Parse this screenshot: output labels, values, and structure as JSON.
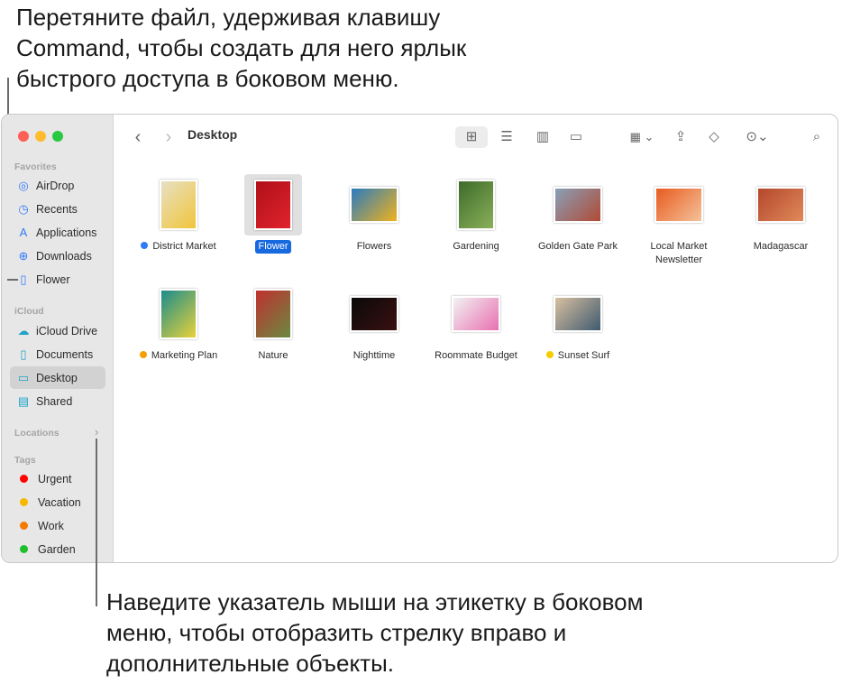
{
  "callouts": {
    "top": "Перетяните файл, удерживая клавишу Command, чтобы создать для него ярлык быстрого доступа в боковом меню.",
    "bottom": "Наведите указатель мыши на этикетку в боковом меню, чтобы отобразить стрелку вправо и дополнительные объекты."
  },
  "sidebar": {
    "favorites_label": "Favorites",
    "favorites": [
      {
        "label": "AirDrop",
        "icon": "airdrop-icon"
      },
      {
        "label": "Recents",
        "icon": "clock-icon"
      },
      {
        "label": "Applications",
        "icon": "applications-icon"
      },
      {
        "label": "Downloads",
        "icon": "download-icon"
      },
      {
        "label": "Flower",
        "icon": "document-icon"
      }
    ],
    "icloud_label": "iCloud",
    "icloud": [
      {
        "label": "iCloud Drive",
        "icon": "cloud-icon"
      },
      {
        "label": "Documents",
        "icon": "document-icon"
      },
      {
        "label": "Desktop",
        "icon": "desktop-icon"
      },
      {
        "label": "Shared",
        "icon": "shared-folder-icon"
      }
    ],
    "locations_label": "Locations",
    "tags_label": "Tags",
    "tags": [
      {
        "label": "Urgent",
        "color": "#fe0000"
      },
      {
        "label": "Vacation",
        "color": "#f5b700"
      },
      {
        "label": "Work",
        "color": "#f57a00"
      },
      {
        "label": "Garden",
        "color": "#1dbf2a"
      }
    ]
  },
  "toolbar": {
    "title": "Desktop"
  },
  "files": [
    {
      "name": "District Market",
      "tag": "#2f7bf6",
      "colors": [
        "#e8e0c4",
        "#f0c53a"
      ]
    },
    {
      "name": "Flower",
      "selected": true,
      "colors": [
        "#b0101a",
        "#e0232b"
      ]
    },
    {
      "name": "Flowers",
      "colors": [
        "#2a7bc0",
        "#f0b21c"
      ]
    },
    {
      "name": "Gardening",
      "colors": [
        "#3d6b2a",
        "#8ab05a"
      ]
    },
    {
      "name": "Golden Gate Park",
      "colors": [
        "#88a0b8",
        "#b04a34"
      ]
    },
    {
      "name": "Local Market Newsletter",
      "colors": [
        "#e85b20",
        "#f4c29a"
      ]
    },
    {
      "name": "Madagascar",
      "colors": [
        "#b4472c",
        "#e08a5a"
      ]
    },
    {
      "name": "Marketing Plan",
      "tag": "#f5a000",
      "colors": [
        "#1a8c8c",
        "#e8d23a"
      ]
    },
    {
      "name": "Nature",
      "colors": [
        "#c03030",
        "#6a8a40"
      ]
    },
    {
      "name": "Nighttime",
      "colors": [
        "#0a0a0a",
        "#3a1010"
      ]
    },
    {
      "name": "Roommate Budget",
      "colors": [
        "#f2f2f2",
        "#e870b0"
      ]
    },
    {
      "name": "Sunset Surf",
      "tag": "#f5cc00",
      "colors": [
        "#d8c0a0",
        "#405a70"
      ]
    }
  ]
}
